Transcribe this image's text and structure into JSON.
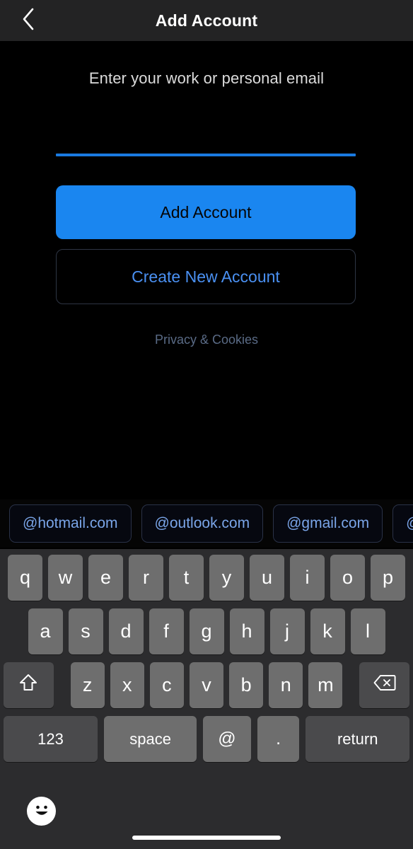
{
  "navbar": {
    "back_icon": "chevron-left-icon",
    "title": "Add Account"
  },
  "form": {
    "subtitle": "Enter your work or personal email",
    "email_value": "",
    "email_placeholder": "",
    "primary_button": "Add Account",
    "secondary_button": "Create New Account",
    "privacy_link": "Privacy & Cookies"
  },
  "suggestions": {
    "chips": [
      {
        "label": "@hotmail.com"
      },
      {
        "label": "@outlook.com"
      },
      {
        "label": "@gmail.com"
      },
      {
        "label": "@"
      }
    ]
  },
  "keyboard": {
    "row1": [
      "q",
      "w",
      "e",
      "r",
      "t",
      "y",
      "u",
      "i",
      "o",
      "p"
    ],
    "row2": [
      "a",
      "s",
      "d",
      "f",
      "g",
      "h",
      "j",
      "k",
      "l"
    ],
    "row3": [
      "z",
      "x",
      "c",
      "v",
      "b",
      "n",
      "m"
    ],
    "shift_icon": "shift-arrow-icon",
    "backspace_icon": "backspace-delete-icon",
    "numbers_key": "123",
    "space_key": "space",
    "at_key": "@",
    "dot_key": ".",
    "return_key": "return",
    "emoji_icon": "smiley-face-icon"
  },
  "colors": {
    "accent_blue": "#1a86f0",
    "underline_blue": "#1a7ae0",
    "link_blue": "#4a90f2",
    "chip_text": "#7aa5e8",
    "navbar_bg": "#232324",
    "keyboard_bg": "#2c2c2e",
    "key_bg": "#6e6e6e",
    "key_dark_bg": "#4a4a4c",
    "page_bg": "#000000"
  }
}
